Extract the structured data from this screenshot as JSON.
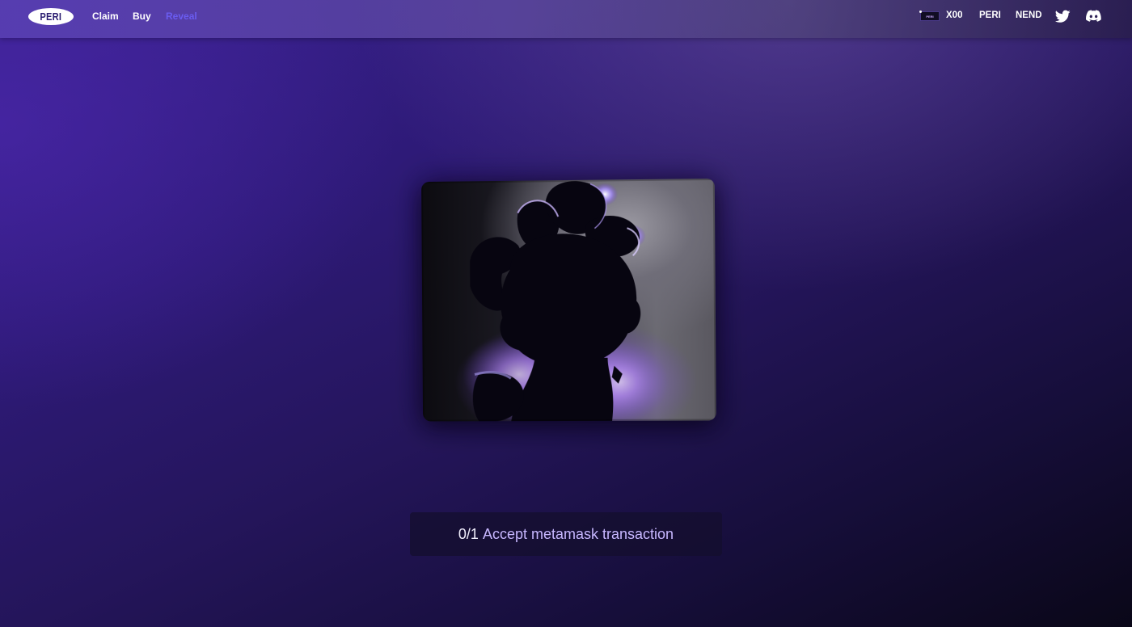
{
  "nav": {
    "logo_text": "PERI",
    "links": [
      {
        "label": "Claim",
        "active": false
      },
      {
        "label": "Buy",
        "active": false
      },
      {
        "label": "Reveal",
        "active": true
      }
    ],
    "right": {
      "token_chip_text": "PERI",
      "token_label": "X00",
      "peri_label": "PERI",
      "nend_label": "NEND",
      "twitter_icon": "twitter-icon",
      "discord_icon": "discord-icon"
    }
  },
  "status": {
    "count": "0/1",
    "message": "Accept metamask transaction"
  },
  "colors": {
    "active_link": "#6a5cf0",
    "status_text": "#c7b7ff"
  }
}
